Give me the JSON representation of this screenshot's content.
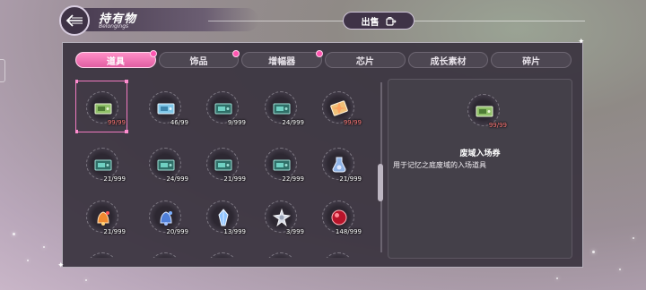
{
  "header": {
    "title_cn": "持有物",
    "title_en": "Belongings",
    "sell_label": "出售"
  },
  "tabs": [
    {
      "label": "道具",
      "active": true,
      "badge": true
    },
    {
      "label": "饰品",
      "active": false,
      "badge": true
    },
    {
      "label": "增幅器",
      "active": false,
      "badge": true
    },
    {
      "label": "芯片",
      "active": false,
      "badge": false
    },
    {
      "label": "成长素材",
      "active": false,
      "badge": false
    },
    {
      "label": "碎片",
      "active": false,
      "badge": false
    }
  ],
  "items": [
    {
      "icon": "ticket-green-icon",
      "count": "99/99",
      "maxed": true,
      "selected": true
    },
    {
      "icon": "ticket-blue-icon",
      "count": "46/99",
      "maxed": false
    },
    {
      "icon": "ticket-teal-icon",
      "count": "9/999",
      "maxed": false
    },
    {
      "icon": "ticket-teal-icon",
      "count": "24/999",
      "maxed": false
    },
    {
      "icon": "ticket-gold-icon",
      "count": "99/99",
      "maxed": true
    },
    {
      "icon": "ticket-teal-icon",
      "count": "21/999",
      "maxed": false
    },
    {
      "icon": "ticket-teal-icon",
      "count": "24/999",
      "maxed": false
    },
    {
      "icon": "ticket-teal-icon",
      "count": "21/999",
      "maxed": false
    },
    {
      "icon": "ticket-teal-icon",
      "count": "22/999",
      "maxed": false
    },
    {
      "icon": "crystal-flask-icon",
      "count": "21/999",
      "maxed": false
    },
    {
      "icon": "orange-bell-icon",
      "count": "21/999",
      "maxed": false
    },
    {
      "icon": "blue-bell-icon",
      "count": "20/999",
      "maxed": false
    },
    {
      "icon": "blue-crystal-icon",
      "count": "13/999",
      "maxed": false
    },
    {
      "icon": "silver-ornament-icon",
      "count": "3/999",
      "maxed": false
    },
    {
      "icon": "red-gem-icon",
      "count": "148/999",
      "maxed": false
    },
    {
      "icon": "dark-orb-icon",
      "count": "",
      "maxed": false
    },
    {
      "icon": "gold-orb-icon",
      "count": "",
      "maxed": false
    },
    {
      "icon": "silver-orb-icon",
      "count": "",
      "maxed": false
    },
    {
      "icon": "dark-orb-icon",
      "count": "",
      "maxed": false
    },
    {
      "icon": "silver-orb-icon",
      "count": "",
      "maxed": false
    }
  ],
  "detail": {
    "icon": "ticket-green-icon",
    "count": "99/99",
    "name": "废域入场券",
    "description": "用于记忆之庭废域的入场道具"
  },
  "colors": {
    "accent_pink": "#e25ea3",
    "panel_bg": "#3a3440",
    "max_count_red": "#ff7a7a"
  }
}
